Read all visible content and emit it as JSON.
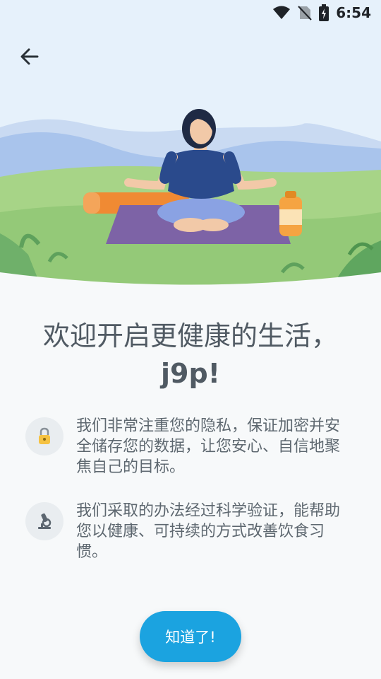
{
  "status_bar": {
    "time": "6:54"
  },
  "welcome": {
    "line1": "欢迎开启更健康的生活，",
    "line2": "j9p!"
  },
  "features": [
    {
      "text": "我们非常注重您的隐私，保证加密并安全储存您的数据，让您安心、自信地聚焦自己的目标。",
      "icon": "lock-icon"
    },
    {
      "text": "我们采取的办法经过科学验证，能帮助您以健康、可持续的方式改善饮食习惯。",
      "icon": "microscope-icon"
    }
  ],
  "button": {
    "label": "知道了!"
  },
  "colors": {
    "accent": "#1ba3e0",
    "text": "#505a63",
    "sky": "#e6f1fa",
    "grass": "#8fc87a"
  }
}
